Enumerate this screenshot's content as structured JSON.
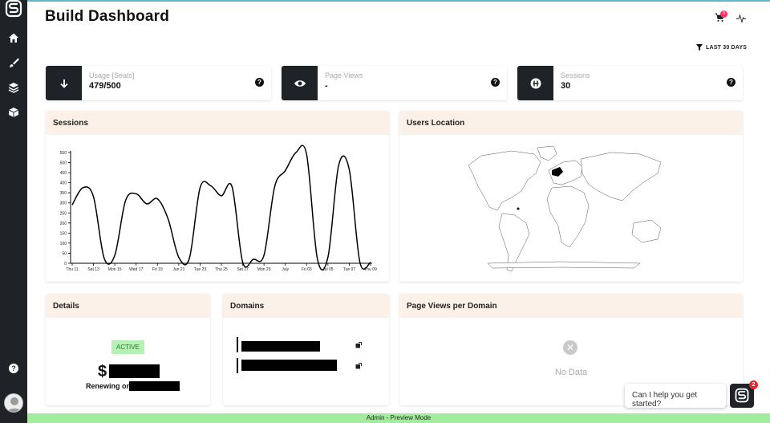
{
  "sidebar": {
    "logo_icon": "brand-s-logo",
    "items": [
      {
        "icon": "home-icon"
      },
      {
        "icon": "brush-icon"
      },
      {
        "icon": "layers-icon"
      },
      {
        "icon": "cube-icon"
      }
    ],
    "help_label": "?"
  },
  "header": {
    "title": "Build Dashboard",
    "cart_badge": "0",
    "filter_label": "LAST 30 DAYS"
  },
  "stats": [
    {
      "label": "Usage [Seats]",
      "value": "479/500",
      "icon": "arrow-down-icon",
      "help": "?"
    },
    {
      "label": "Page Views",
      "value": "-",
      "icon": "eye-icon",
      "help": "?"
    },
    {
      "label": "Sessions",
      "value": "30",
      "icon": "sessions-icon",
      "help": "?"
    }
  ],
  "panels": {
    "sessions": "Sessions",
    "users_location": "Users Location",
    "details": "Details",
    "domains": "Domains",
    "page_views_per_domain": "Page Views per Domain"
  },
  "details": {
    "status": "ACTIVE",
    "currency": "$",
    "renewing_label": "Renewing on"
  },
  "page_views_domain": {
    "no_data_icon": "✕",
    "no_data_text": "No Data"
  },
  "footer": {
    "preview_text": "Admin - Preview Mode"
  },
  "chat": {
    "prompt": "Can I help you get started?",
    "badge": "2"
  },
  "chart_data": {
    "type": "line",
    "title": "",
    "xlabel": "",
    "ylabel": "",
    "ylim": [
      0,
      550
    ],
    "yticks": [
      0,
      50,
      100,
      150,
      200,
      250,
      300,
      350,
      400,
      450,
      500,
      550
    ],
    "x_ticks": [
      "Thu 11",
      "Sat 13",
      "Mon 15",
      "Wed 17",
      "Fri 19",
      "Jun 21",
      "Tue 23",
      "Thu 25",
      "Sat 27",
      "Mon 29",
      "July",
      "Fri 03",
      "Jul 05",
      "Tue 07",
      "Thu 09"
    ],
    "x": [
      0,
      0.5,
      1,
      1.5,
      2,
      2.5,
      3,
      3.5,
      4,
      4.5,
      5,
      5.5,
      6,
      6.5,
      7,
      7.5,
      8,
      8.5,
      9,
      9.5,
      10,
      10.5,
      11,
      11.5,
      12,
      12.5,
      13,
      13.5,
      14
    ],
    "series": [
      {
        "values": [
          290,
          375,
          330,
          25,
          40,
          310,
          345,
          295,
          320,
          220,
          30,
          25,
          375,
          385,
          335,
          380,
          5,
          20,
          40,
          380,
          460,
          550,
          540,
          25,
          30,
          485,
          465,
          5,
          5
        ]
      }
    ],
    "grid": false,
    "legend": "none"
  }
}
